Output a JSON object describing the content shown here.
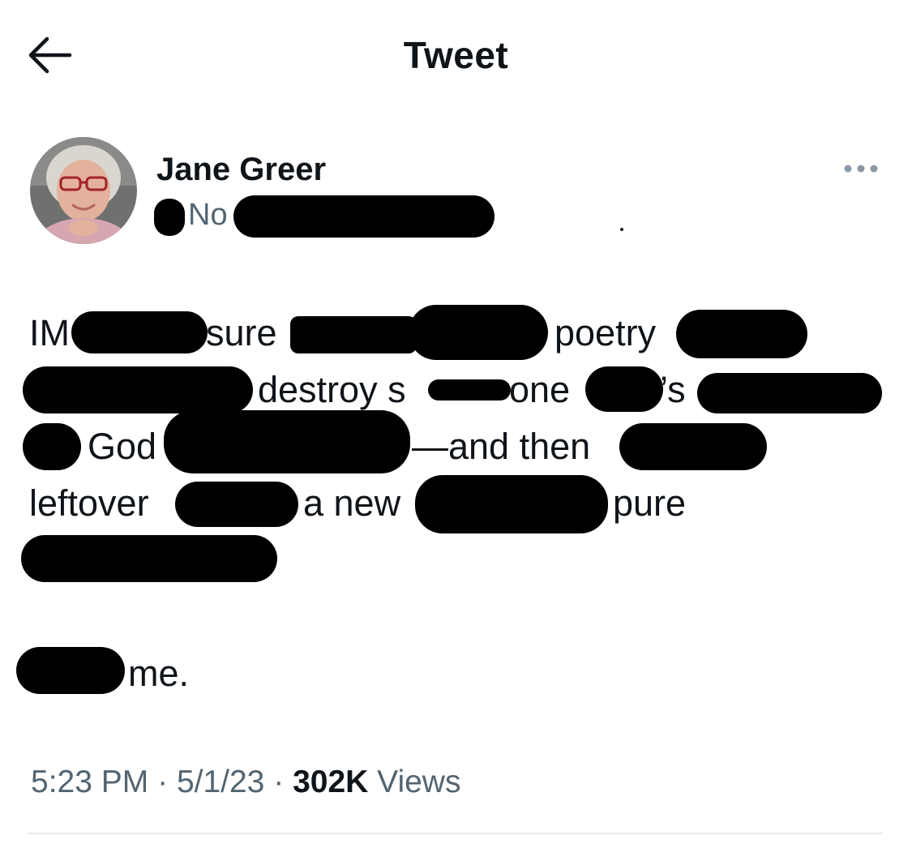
{
  "header": {
    "title": "Tweet",
    "back_icon": "arrow-left-icon"
  },
  "author": {
    "display_name": "Jane Greer",
    "handle_visible": "No",
    "avatar_icon": "user-avatar"
  },
  "more_icon": "more-horizontal-icon",
  "tweet": {
    "fragments": {
      "im": "IM",
      "sure": "sure",
      "poetry": "poetry",
      "destroy_s": "destroy s",
      "one": "one",
      "apos_s": "’s",
      "god": "God",
      "and_then": "—and then",
      "leftover": "leftover",
      "a_new": "a new",
      "pure": "pure",
      "me": "me."
    },
    "redaction_color": "#000000"
  },
  "meta": {
    "time": "5:23 PM",
    "sep1": "·",
    "date": "5/1/23",
    "sep2": "·",
    "views_count": "302K",
    "views_label": "Views"
  },
  "colors": {
    "text_primary": "#0f1419",
    "text_secondary": "#536471",
    "divider": "#e6e9ec",
    "background": "#ffffff"
  }
}
